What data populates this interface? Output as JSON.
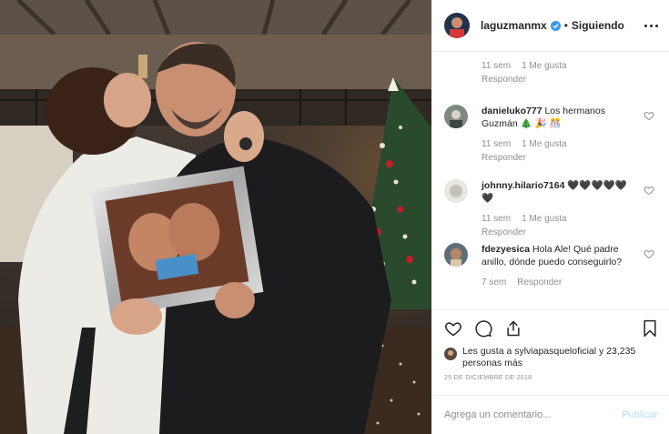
{
  "header": {
    "username": "laguzmanmx",
    "separator": "•",
    "follow_label": "Siguiendo"
  },
  "comments": [
    {
      "user": "",
      "text": "",
      "time": "11 sem",
      "likes": "1 Me gusta",
      "reply": "Responder"
    },
    {
      "user": "danieluko777",
      "text": "Los hermanos Guzmán 🎄 🎉 🎊",
      "time": "11 sem",
      "likes": "1 Me gusta",
      "reply": "Responder"
    },
    {
      "user": "johnny.hilario7164",
      "text": "🖤🖤🖤🖤🖤🖤",
      "time": "11 sem",
      "likes": "1 Me gusta",
      "reply": "Responder"
    },
    {
      "user": "fdezyesica",
      "text": "Hola Ale! Qué padre anillo, dónde puedo conseguirlo?",
      "time": "7 sem",
      "likes": "",
      "reply": "Responder"
    }
  ],
  "likes_text": "Les gusta a sylviapasqueloficial y 23,235 personas más",
  "date": "25 DE DICIEMBRE DE 2018",
  "add_comment": {
    "placeholder": "Agrega un comentario...",
    "publish": "Publicar"
  },
  "colors": {
    "text": "#262626",
    "muted": "#8e8e8e",
    "divider": "#efefef",
    "verified": "#3897f0",
    "publish_disabled": "#b2dffc"
  },
  "icons": [
    "verified-badge-icon",
    "more-options-icon",
    "heart-icon",
    "comment-icon",
    "share-icon",
    "bookmark-icon"
  ]
}
